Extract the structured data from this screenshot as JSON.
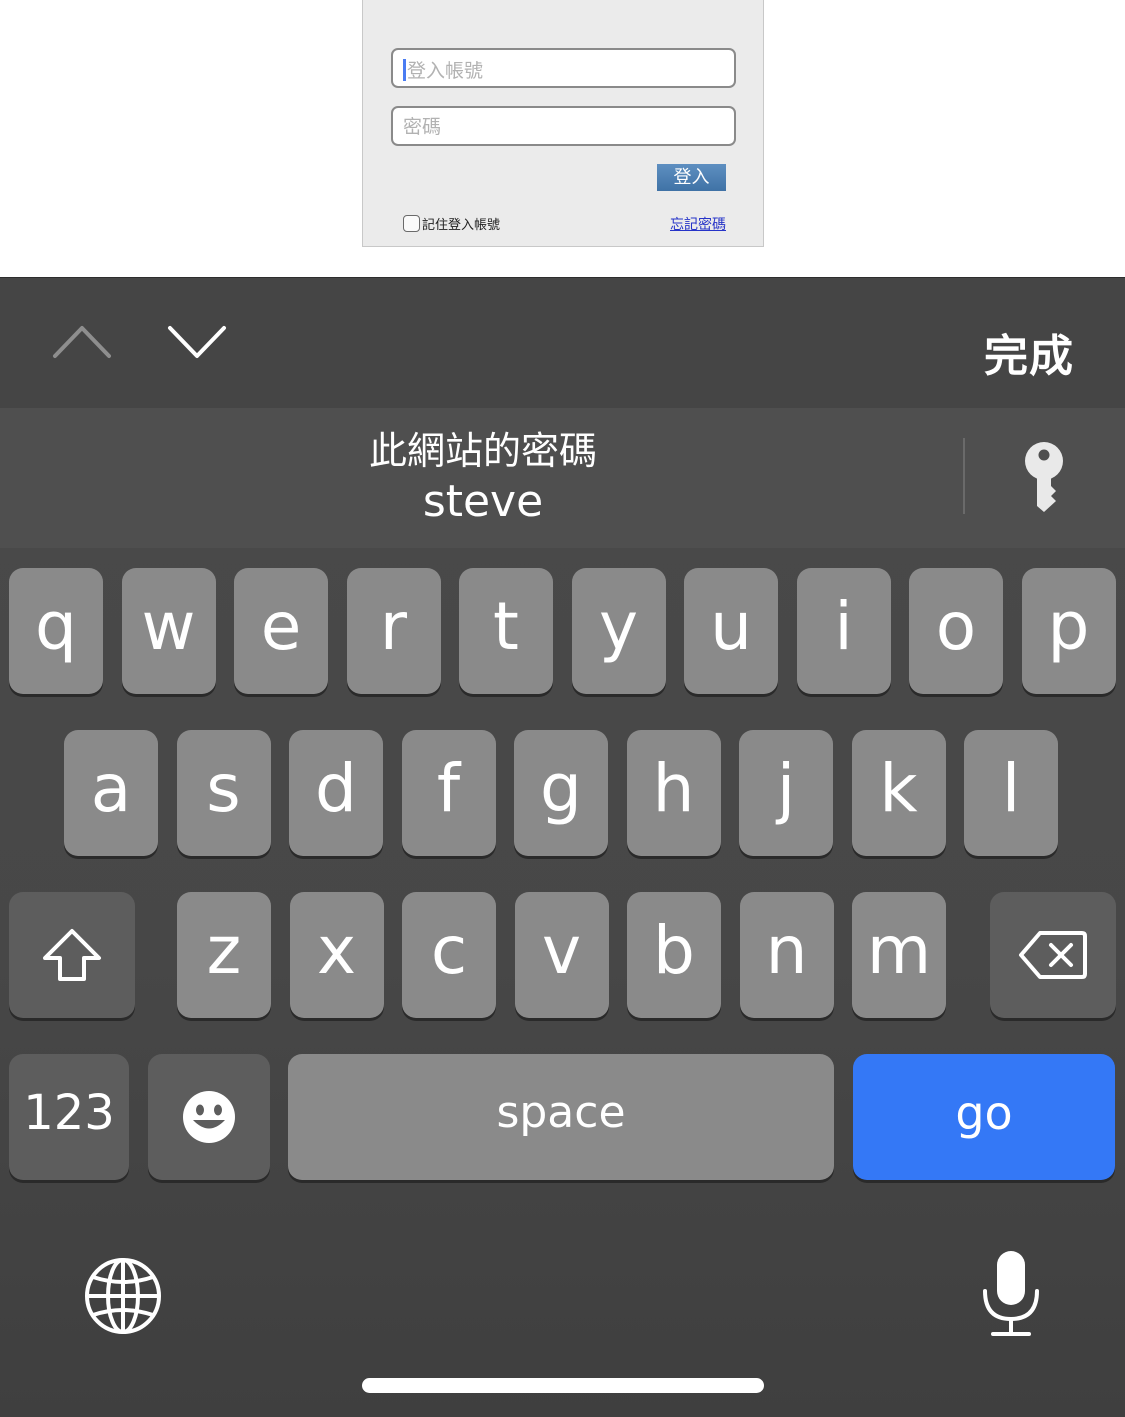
{
  "login": {
    "username_placeholder": "登入帳號",
    "password_placeholder": "密碼",
    "login_button": "登入",
    "remember_label": "記住登入帳號",
    "forgot_link": "忘記密碼"
  },
  "accessory": {
    "done_label": "完成",
    "prev_icon": "chevron-up-icon",
    "next_icon": "chevron-down-icon"
  },
  "suggestion": {
    "title": "此網站的密碼",
    "username": "steve",
    "icon": "key-icon"
  },
  "keyboard": {
    "row1": [
      "q",
      "w",
      "e",
      "r",
      "t",
      "y",
      "u",
      "i",
      "o",
      "p"
    ],
    "row2": [
      "a",
      "s",
      "d",
      "f",
      "g",
      "h",
      "j",
      "k",
      "l"
    ],
    "row3": [
      "z",
      "x",
      "c",
      "v",
      "b",
      "n",
      "m"
    ],
    "numbers_label": "123",
    "space_label": "space",
    "go_label": "go",
    "shift_icon": "shift-icon",
    "delete_icon": "backspace-icon",
    "emoji_icon": "emoji-icon",
    "globe_icon": "globe-icon",
    "mic_icon": "microphone-icon"
  },
  "colors": {
    "go_key": "#3478f6",
    "letter_key": "#8a8a8a",
    "function_key": "#5d5d5d",
    "keyboard_bg": "#474747",
    "forgot_link": "#2633c8"
  }
}
